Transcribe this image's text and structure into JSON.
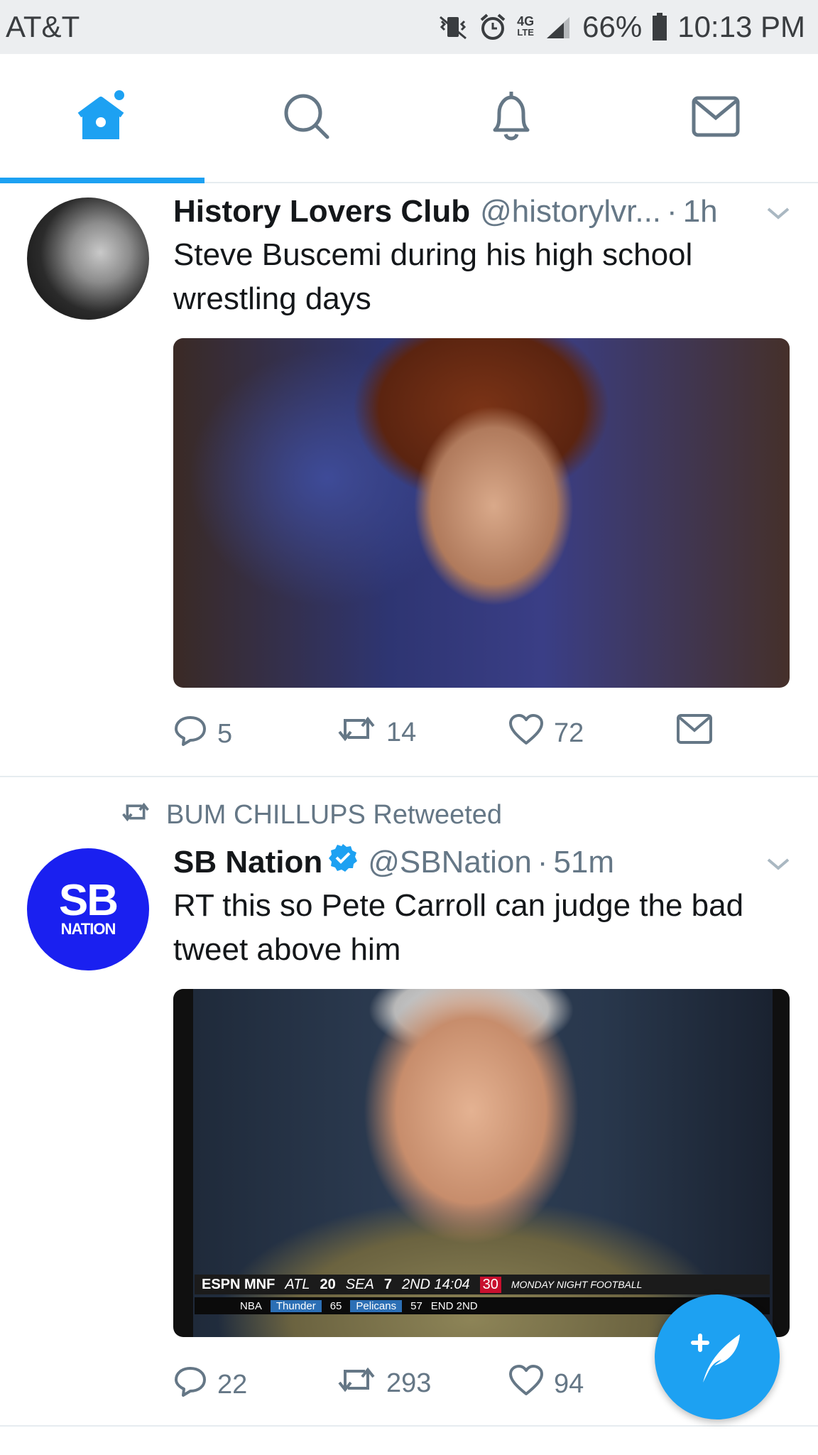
{
  "status_bar": {
    "carrier": "AT&T",
    "network": "4G",
    "network_sub": "LTE",
    "battery": "66%",
    "time": "10:13 PM"
  },
  "tabs": [
    {
      "name": "home",
      "icon": "home-icon",
      "active": true
    },
    {
      "name": "search",
      "icon": "search-icon"
    },
    {
      "name": "notifications",
      "icon": "bell-icon"
    },
    {
      "name": "messages",
      "icon": "mail-icon"
    }
  ],
  "colors": {
    "accent": "#1da1f2",
    "muted": "#657786",
    "sbnation": "#1a20f0"
  },
  "tweets": [
    {
      "name": "History Lovers Club",
      "handle": "@historylvr...",
      "separator": "·",
      "time": "1h",
      "text": "Steve Buscemi during his high school wrestling days",
      "replies": "5",
      "retweets": "14",
      "likes": "72"
    },
    {
      "retweeted_by": "BUM CHILLUPS Retweeted",
      "name": "SB Nation",
      "verified": true,
      "handle": "@SBNation",
      "separator": "·",
      "time": "51m",
      "text": "RT this so Pete Carroll can judge the bad tweet above him",
      "avatar_line1": "SB",
      "avatar_line2": "NATION",
      "replies": "22",
      "retweets": "293",
      "likes": "94",
      "scorebug": {
        "network": "ESPN MNF",
        "team1": "ATL",
        "score1": "20",
        "team2": "SEA",
        "score2": "7",
        "clock": "2ND 14:04",
        "timeout": "30",
        "show": "MONDAY NIGHT FOOTBALL"
      },
      "ticker": {
        "league": "NBA",
        "team1": "Thunder",
        "score1": "65",
        "team2": "Pelicans",
        "score2": "57",
        "status": "END 2ND"
      }
    }
  ]
}
